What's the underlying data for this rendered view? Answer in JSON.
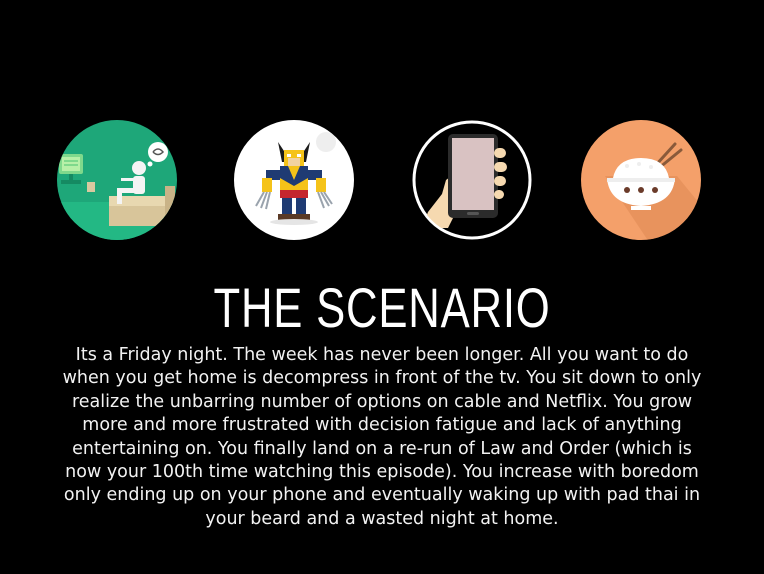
{
  "slide": {
    "title": "THE SCENARIO",
    "body": "Its a Friday night. The week has never been longer. All you want to do when you get home is decompress in front of the tv. You sit down to only realize the unbarring number of options on cable and Netflix. You grow more and more frustrated with decision fatigue and lack of anything entertaining on. You finally land on a re-run of Law and Order (which is now your 100th time watching this episode). You increase with boredom only ending up on your phone and eventually waking up with pad thai in your beard and a wasted night at home."
  },
  "icons": [
    {
      "name": "tv-couch-icon",
      "color": "#1fa679"
    },
    {
      "name": "wolverine-icon",
      "color": "#ffffff"
    },
    {
      "name": "phone-icon",
      "color": "#000000"
    },
    {
      "name": "rice-bowl-icon",
      "color": "#f4a06a"
    }
  ]
}
